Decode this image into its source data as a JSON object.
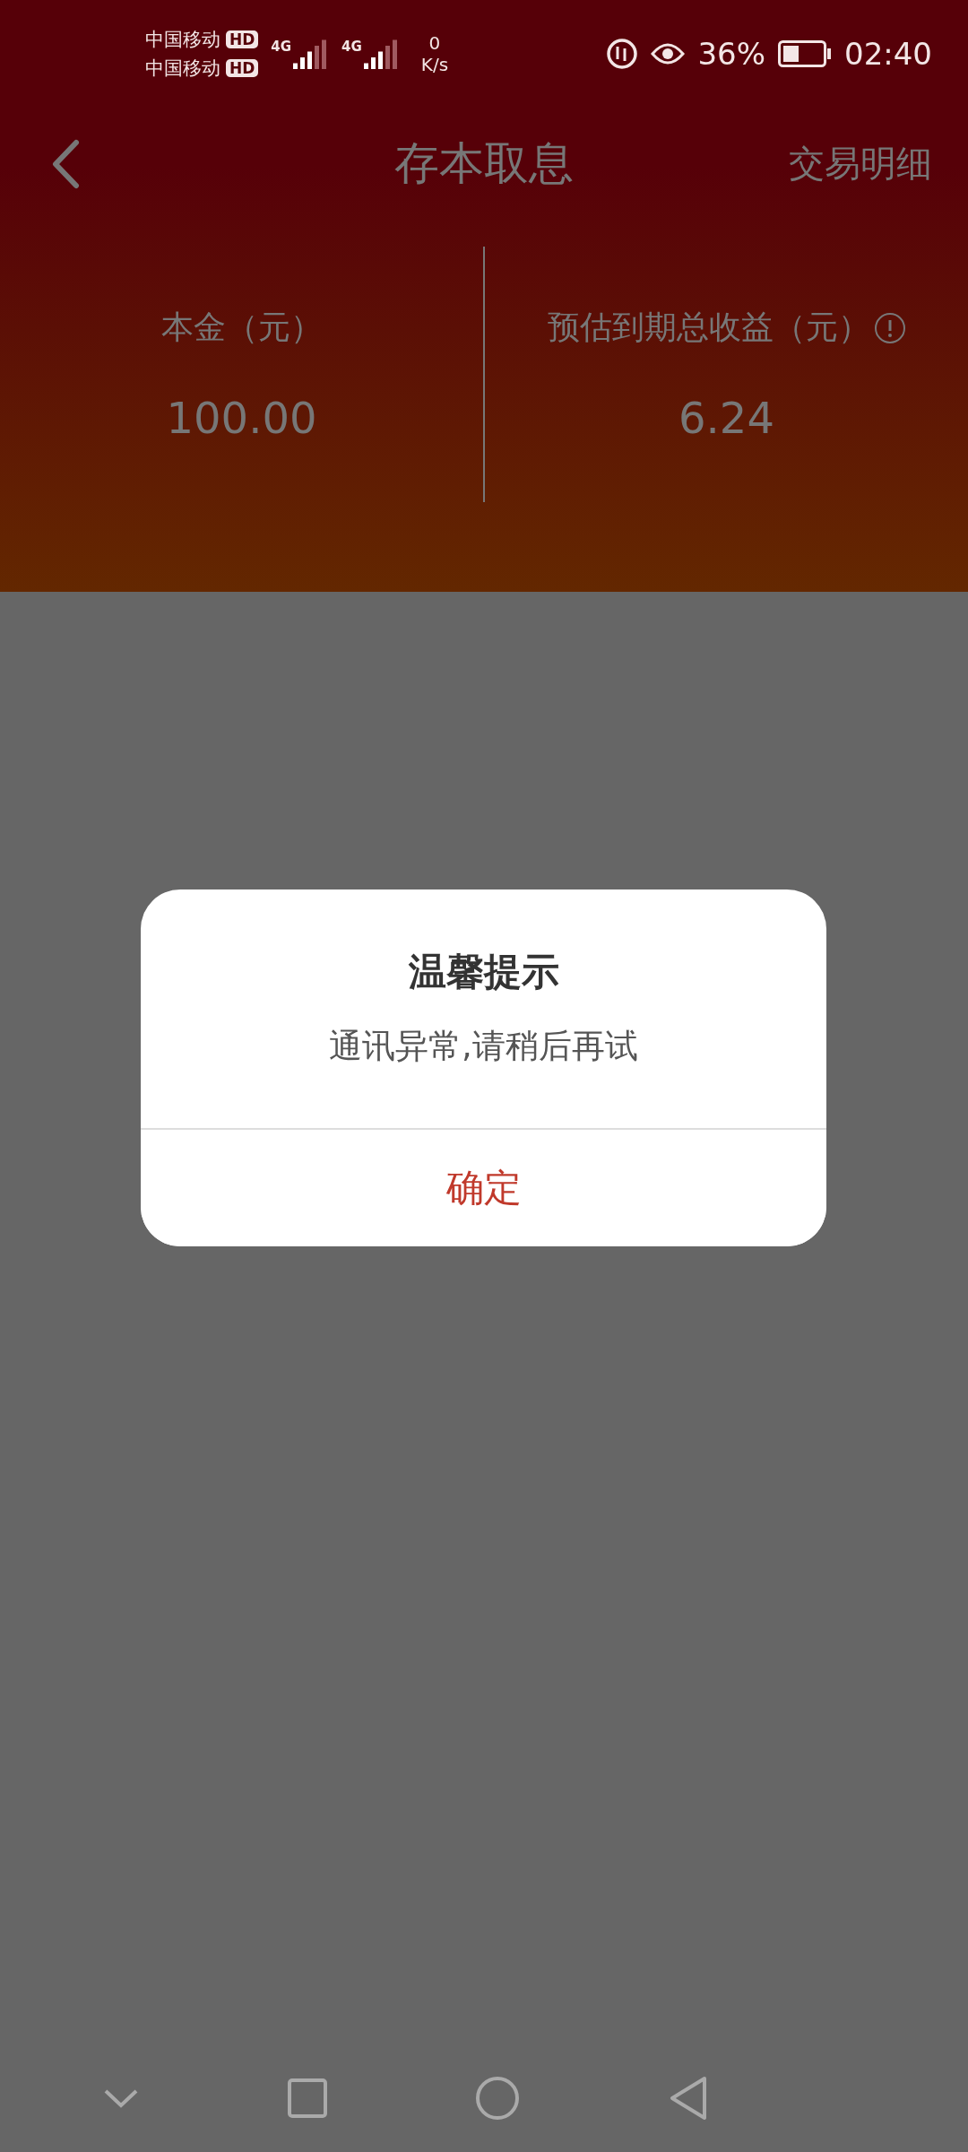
{
  "status_bar": {
    "carriers": [
      {
        "name": "中国移动",
        "badge": "HD"
      },
      {
        "name": "中国移动",
        "badge": "HD"
      }
    ],
    "networks": [
      "4G",
      "4G"
    ],
    "speed_value": "0",
    "speed_unit": "K/s",
    "battery": "36%",
    "time": "02:40"
  },
  "header": {
    "title": "存本取息",
    "action": "交易明细"
  },
  "summary": [
    {
      "label": "本金（元）",
      "value": "100.00",
      "info": false
    },
    {
      "label": "预估到期总收益（元）",
      "value": "6.24",
      "info": true
    }
  ],
  "dialog": {
    "title": "温馨提示",
    "message": "通讯异常,请稍后再试",
    "button": "确定"
  }
}
